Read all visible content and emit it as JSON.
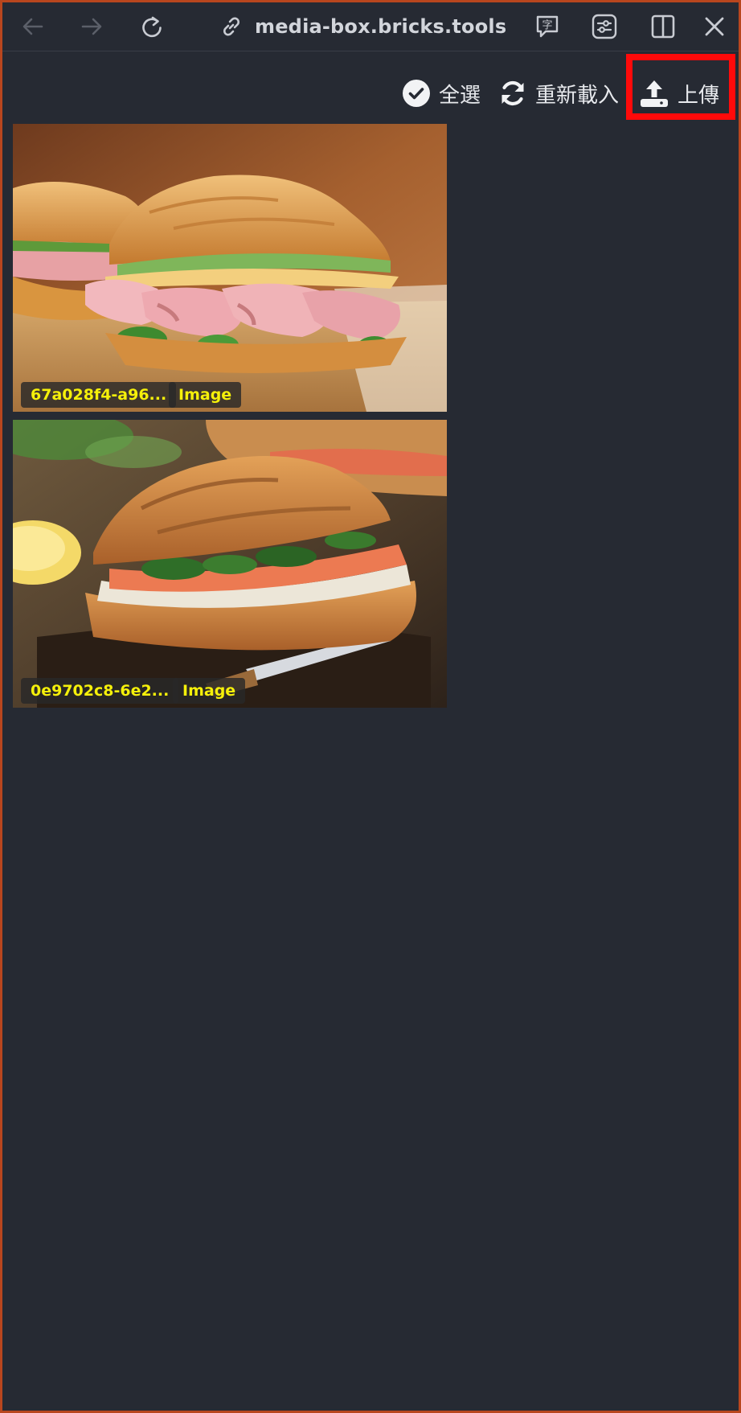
{
  "browser": {
    "url": "media-box.bricks.tools"
  },
  "actions": {
    "select_all_label": "全選",
    "reload_label": "重新載入",
    "upload_label": "上傳"
  },
  "media": [
    {
      "id_label": "67a028f4-a96...",
      "type_label": "Image"
    },
    {
      "id_label": "0e9702c8-6e2...",
      "type_label": "Image"
    }
  ],
  "colors": {
    "background": "#262a33",
    "window_border": "#b8461e",
    "highlight": "#ff0a0a",
    "tag_text": "#f5f00a"
  }
}
